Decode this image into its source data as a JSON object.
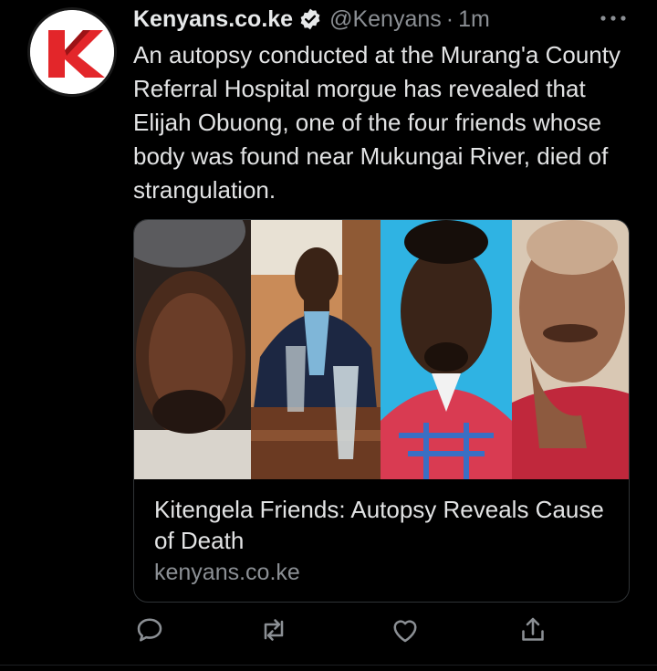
{
  "tweet": {
    "author_name": "Kenyans.co.ke",
    "handle": "@Kenyans",
    "separator": "·",
    "timestamp": "1m",
    "verified": true,
    "text": "An autopsy conducted at the Murang'a County Referral Hospital morgue has revealed that Elijah Obuong, one of the four friends whose body was found near Mukungai River, died of strangulation.",
    "more_icon": "ellipsis-icon"
  },
  "link_card": {
    "title": "Kitengela Friends: Autopsy Reveals Cause of Death",
    "domain": "kenyans.co.ke",
    "photos": [
      {
        "name": "photo-man-cap-selfie"
      },
      {
        "name": "photo-man-table-drinks"
      },
      {
        "name": "photo-man-passport-blue"
      },
      {
        "name": "photo-man-red-shirt"
      }
    ]
  },
  "actions": [
    {
      "icon": "reply-icon"
    },
    {
      "icon": "retweet-icon"
    },
    {
      "icon": "like-icon"
    },
    {
      "icon": "share-icon"
    }
  ],
  "colors": {
    "background": "#000000",
    "text": "#e2e3e4",
    "muted": "#8b8f94",
    "logo_red": "#e3262a"
  }
}
